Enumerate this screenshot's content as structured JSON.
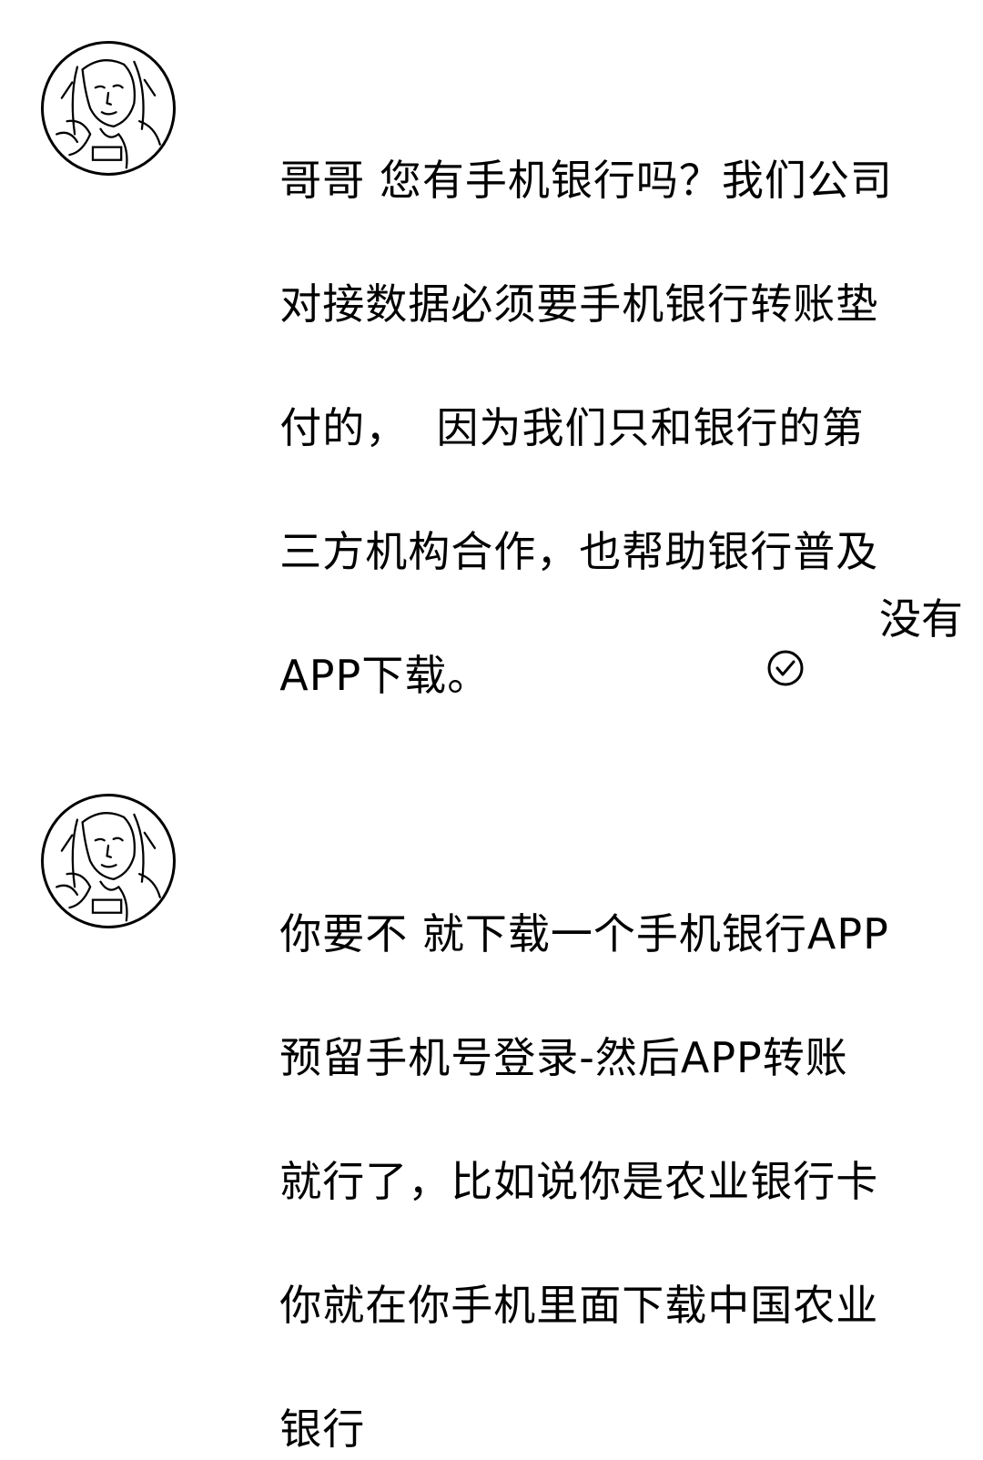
{
  "chat": {
    "messages": [
      {
        "sender": "other",
        "icon": "avatar-portrait",
        "lines": [
          "哥哥 您有手机银行吗？我们公司",
          "对接数据必须要手机银行转账垫",
          "付的，  因为我们只和银行的第",
          "三方机构合作，也帮助银行普及",
          "APP下载。"
        ]
      },
      {
        "sender": "me",
        "text": "没有",
        "status_icon": "read-check-icon"
      },
      {
        "sender": "other",
        "icon": "avatar-portrait",
        "lines": [
          "你要不 就下载一个手机银行APP",
          "预留手机号登录-然后APP转账",
          "就行了，比如说你是农业银行卡",
          "你就在你手机里面下载中国农业",
          "银行"
        ]
      }
    ]
  }
}
